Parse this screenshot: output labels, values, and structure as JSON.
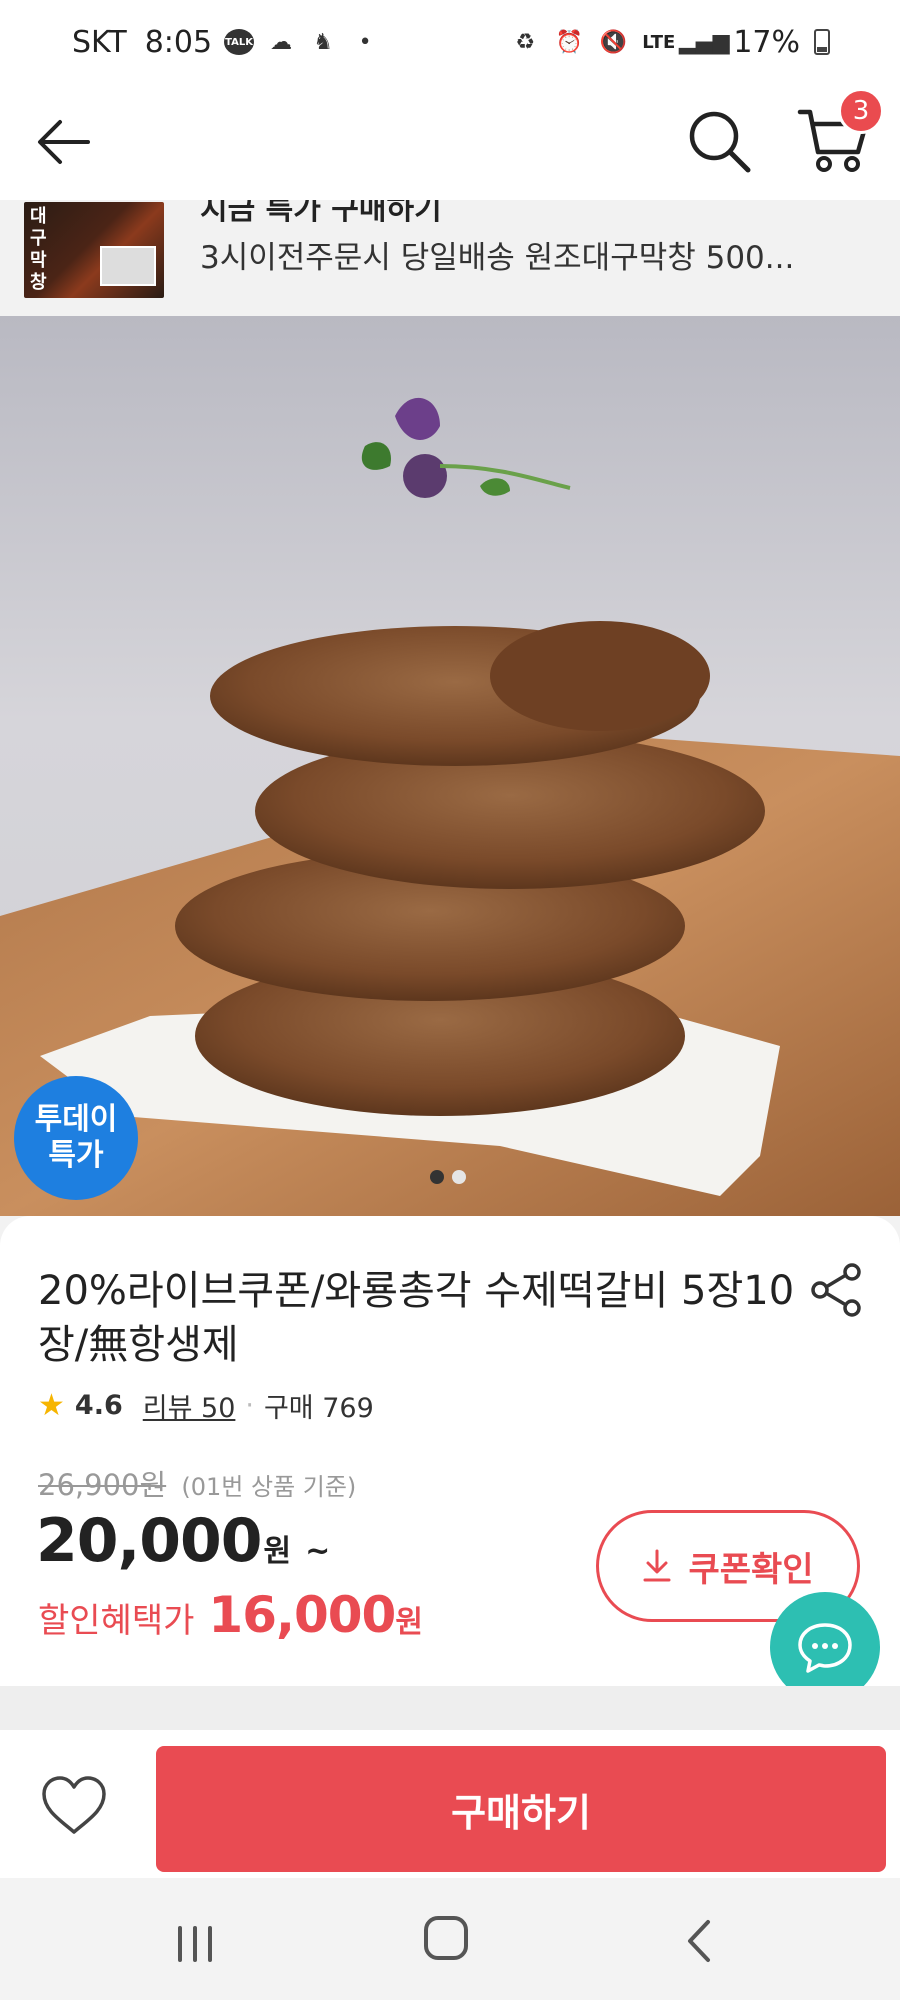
{
  "status_bar": {
    "carrier": "SKT",
    "time": "8:05",
    "talk_label": "TALK",
    "network": "LTE",
    "battery": "17%"
  },
  "header": {
    "cart_count": "3"
  },
  "live_banner": {
    "title": "지금 특가 구매하기",
    "description": "3시이전주문시 당일배송 원조대구막창 500...",
    "thumb_text": "대구막창"
  },
  "hero": {
    "badge_line1": "투데이",
    "badge_line2": "특가",
    "page_count": 2,
    "current_page": 1
  },
  "product": {
    "title": "20%라이브쿠폰/와룡총각 수제떡갈비 5장10장/無항생제",
    "rating": "4.6",
    "review_label": "리뷰 50",
    "purchase_label": "구매 769",
    "original_price": "26,900원",
    "original_note": "(01번 상품 기준)",
    "price": "20,000",
    "price_unit": "원",
    "price_suffix": "~",
    "discount_label": "할인혜택가",
    "discount_price": "16,000",
    "discount_unit": "원",
    "coupon_button": "쿠폰확인"
  },
  "actions": {
    "buy_button": "구매하기"
  },
  "icons": {
    "back": "arrow-left-icon",
    "search": "search-icon",
    "cart": "cart-icon",
    "share": "share-icon",
    "chat": "chat-icon",
    "like": "heart-icon",
    "download": "download-icon"
  },
  "colors": {
    "accent": "#e94b52",
    "chat_fab": "#2dbfb2",
    "today_badge": "#1e7fe0",
    "star": "#f6b500"
  }
}
